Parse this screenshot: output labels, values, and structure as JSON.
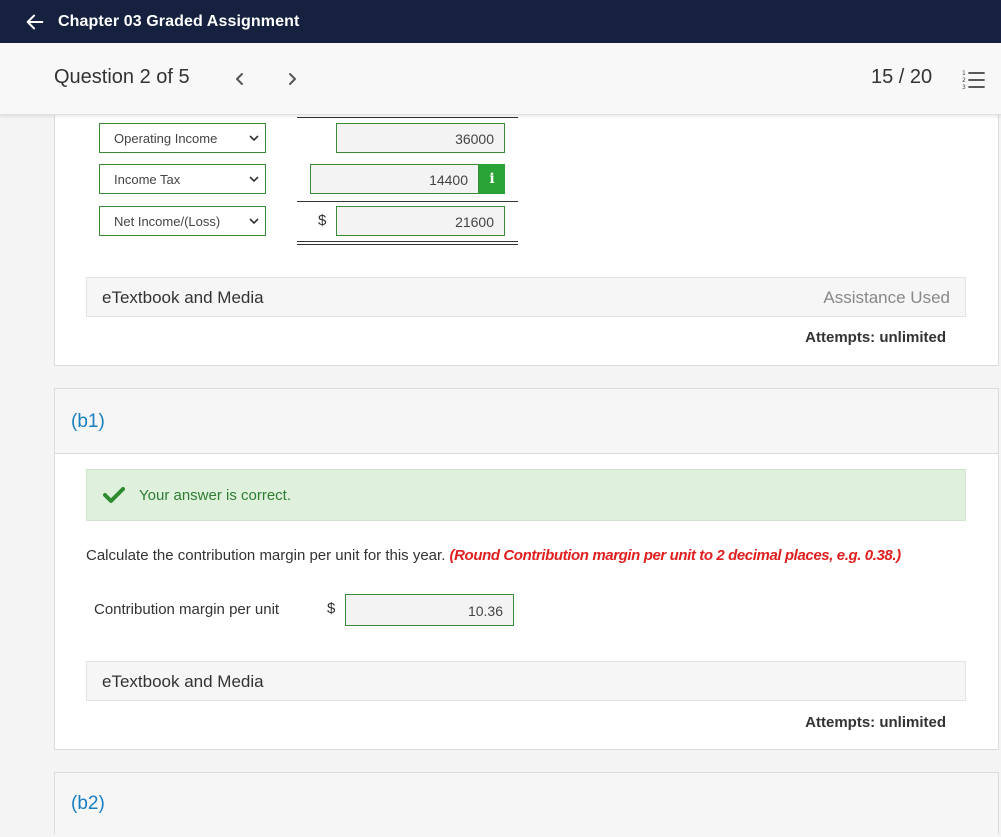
{
  "header": {
    "title": "Chapter 03 Graded Assignment"
  },
  "question_bar": {
    "question_label": "Question 2 of 5",
    "score": "15 / 20"
  },
  "part_a": {
    "rows": [
      {
        "select": "Operating Income",
        "dollar": "",
        "value": "36000"
      },
      {
        "select": "Income Tax",
        "dollar": "",
        "value": "14400"
      },
      {
        "select": "Net Income/(Loss)",
        "dollar": "$",
        "value": "21600"
      }
    ],
    "info_icon": "i",
    "etextbook": "eTextbook and Media",
    "assistance": "Assistance Used",
    "attempts": "Attempts: unlimited"
  },
  "part_b1": {
    "label": "(b1)",
    "feedback": "Your answer is correct.",
    "instruction": "Calculate the contribution margin per unit for this year.",
    "rounding_note": "(Round Contribution margin per unit to 2 decimal places, e.g. 0.38.)",
    "field_label": "Contribution margin per unit",
    "dollar": "$",
    "value": "10.36",
    "etextbook": "eTextbook and Media",
    "attempts": "Attempts: unlimited"
  },
  "part_b2": {
    "label": "(b2)"
  },
  "colors": {
    "header_bg": "#15213f",
    "part_label": "#1a7fc1",
    "success_green": "#2aa336",
    "rounding_red": "#e02020"
  }
}
